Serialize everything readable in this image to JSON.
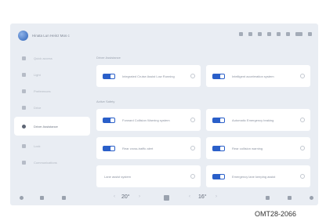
{
  "status_bar": {
    "profile_name": "Hinata Lun Heinz Mos c"
  },
  "sidebar": {
    "items": [
      {
        "label": "Quick access"
      },
      {
        "label": "Light"
      },
      {
        "label": "Preferences"
      },
      {
        "label": "Drive"
      },
      {
        "label": "Driver Assistance",
        "active": true
      },
      {
        "label": "Lock"
      },
      {
        "label": "Communications"
      }
    ]
  },
  "main": {
    "sections": [
      {
        "title": "Driver Assistance",
        "cards": [
          {
            "label": "Integrated Cruise Assist Low Running",
            "enabled": true
          },
          {
            "label": "Intelligent acceleration system",
            "enabled": true
          }
        ]
      },
      {
        "title": "Active Safety",
        "cards": [
          {
            "label": "Forward Collision Warning system",
            "enabled": true
          },
          {
            "label": "Automatic Emergency braking",
            "enabled": true
          },
          {
            "label": "Rear cross-traffic alert",
            "enabled": true
          },
          {
            "label": "Rear collision warning",
            "enabled": true
          },
          {
            "label": "Lane assist system",
            "enabled": false
          },
          {
            "label": "Emergency lane keeping assist",
            "enabled": true
          }
        ]
      }
    ]
  },
  "bottom_bar": {
    "left_temperature": "20°",
    "right_temperature": "16°"
  },
  "figure_code": "OMT28-2066",
  "colors": {
    "accent": "#2a5fc9",
    "background": "#e9edf3",
    "card": "#ffffff"
  }
}
